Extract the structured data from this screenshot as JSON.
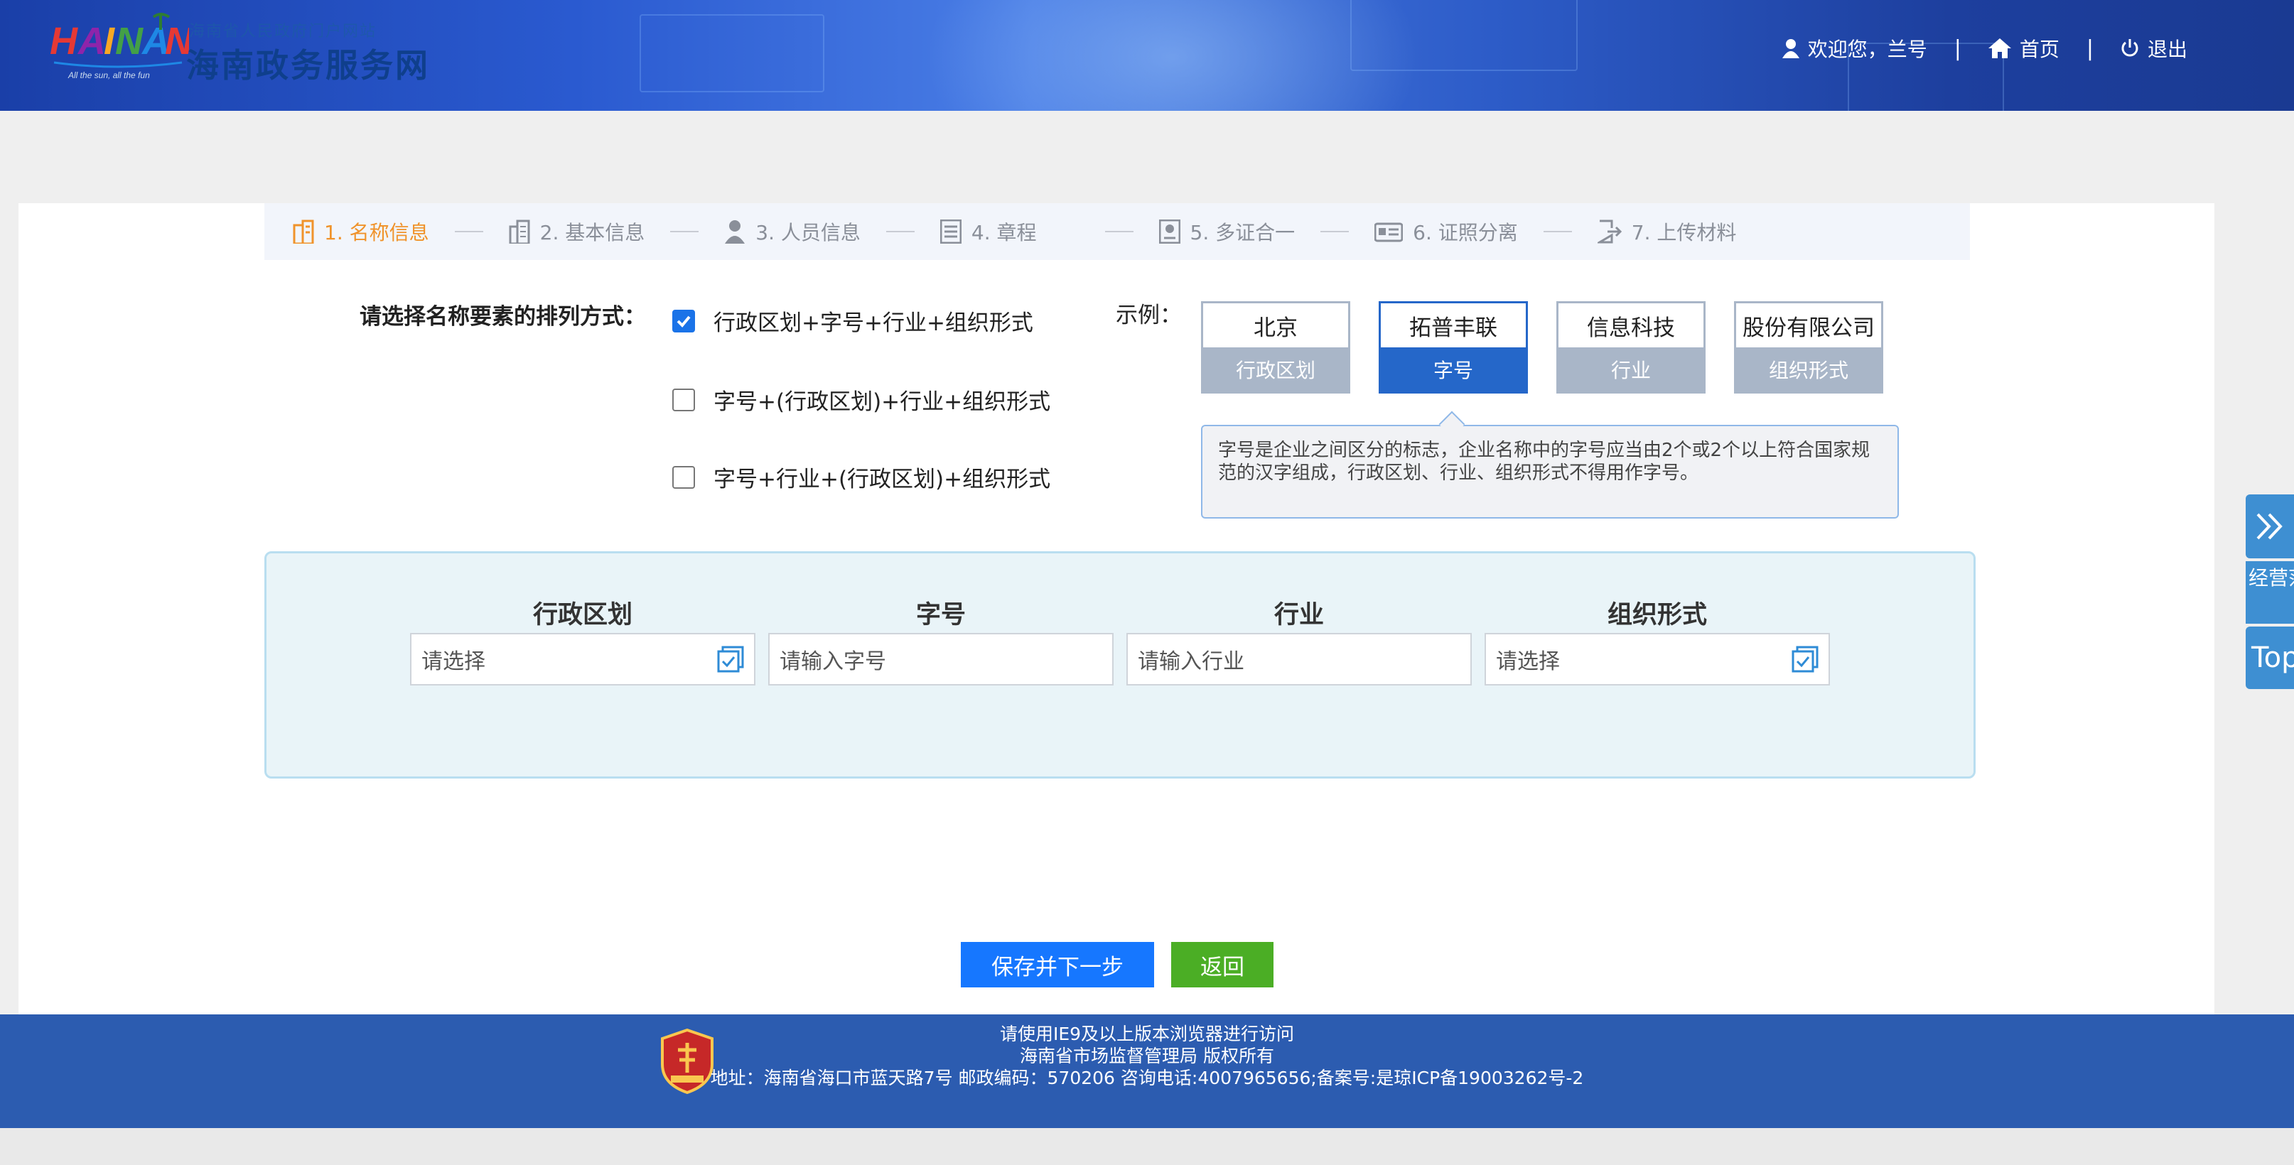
{
  "header": {
    "logo_text": "HAINAN",
    "logo_tagline": "All the sun, all the fun",
    "logo_subtitle": "海南省人民政府门户网站",
    "site_title": "海南政务服务网",
    "welcome": "欢迎您，兰号",
    "home": "首页",
    "logout": "退出",
    "separator": "|"
  },
  "steps": [
    {
      "label": "1. 名称信息",
      "icon": "building-icon",
      "active": true
    },
    {
      "label": "2. 基本信息",
      "icon": "office-icon",
      "active": false
    },
    {
      "label": "3. 人员信息",
      "icon": "person-icon",
      "active": false
    },
    {
      "label": "4. 章程",
      "icon": "list-icon",
      "active": false
    },
    {
      "label": "5. 多证合一",
      "icon": "certificate-icon",
      "active": false
    },
    {
      "label": "6. 证照分离",
      "icon": "card-icon",
      "active": false
    },
    {
      "label": "7. 上传材料",
      "icon": "upload-icon",
      "active": false
    }
  ],
  "arrangement": {
    "label": "请选择名称要素的排列方式：",
    "options": [
      {
        "text": "行政区划+字号+行业+组织形式",
        "checked": true
      },
      {
        "text": "字号+(行政区划)+行业+组织形式",
        "checked": false
      },
      {
        "text": "字号+行业+(行政区划)+组织形式",
        "checked": false
      }
    ]
  },
  "example": {
    "label": "示例：",
    "boxes": [
      {
        "value": "北京",
        "tag": "行政区划",
        "active": false
      },
      {
        "value": "拓普丰联",
        "tag": "字号",
        "active": true
      },
      {
        "value": "信息科技",
        "tag": "行业",
        "active": false
      },
      {
        "value": "股份有限公司",
        "tag": "组织形式",
        "active": false
      }
    ],
    "tip": "字号是企业之间区分的标志，企业名称中的字号应当由2个或2个以上符合国家规范的汉字组成，行政区划、行业、组织形式不得用作字号。"
  },
  "form": {
    "fields": [
      {
        "label": "行政区划",
        "placeholder": "请选择",
        "has_picker": true
      },
      {
        "label": "字号",
        "placeholder": "请输入字号",
        "has_picker": false
      },
      {
        "label": "行业",
        "placeholder": "请输入行业",
        "has_picker": false
      },
      {
        "label": "组织形式",
        "placeholder": "请选择",
        "has_picker": true
      }
    ]
  },
  "buttons": {
    "save_next": "保存并下一步",
    "back": "返回"
  },
  "float": {
    "scope": "经营范围查询",
    "top": "Top"
  },
  "footer": {
    "line1": "请使用IE9及以上版本浏览器进行访问",
    "line2": "海南省市场监督管理局 版权所有",
    "line3": "地址：海南省海口市蓝天路7号 邮政编码：570206 咨询电话:4007965656;备案号:是琼ICP备19003262号-2"
  },
  "colors": {
    "header_blue": "#2a5ad0",
    "active_step": "#f0932b",
    "primary_button": "#1677ff",
    "back_button": "#4bae25",
    "example_active": "#2567c9",
    "footer_blue": "#2c5cb0"
  }
}
